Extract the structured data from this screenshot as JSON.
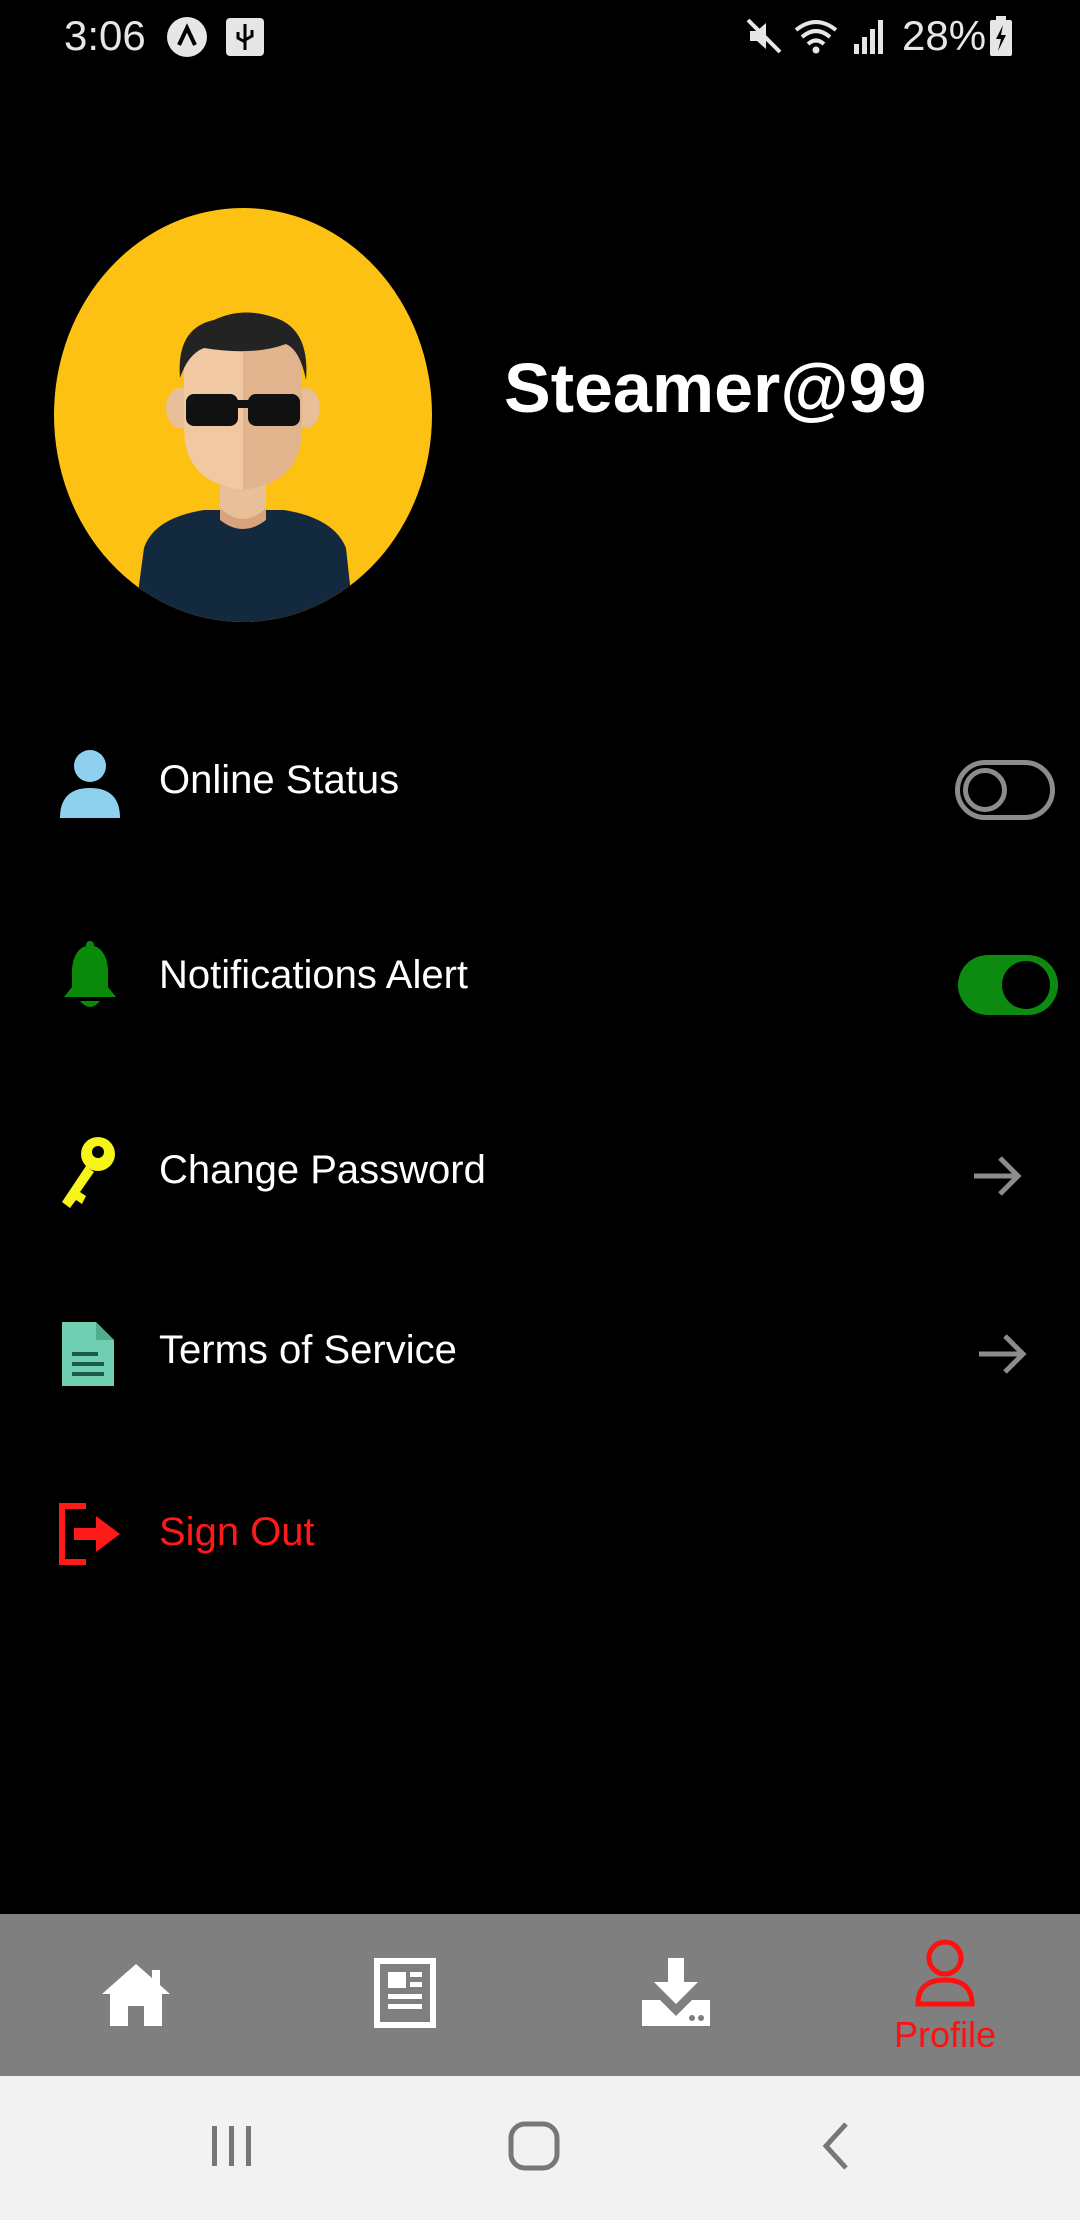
{
  "status_bar": {
    "time": "3:06",
    "battery": "28%",
    "icons": [
      "a-badge-icon",
      "usb-icon",
      "mute-icon",
      "wifi-icon",
      "signal-icon",
      "battery-charging-icon"
    ]
  },
  "profile": {
    "username": "Steamer@99",
    "avatar_bg": "#fdc113"
  },
  "settings": {
    "online_status": {
      "label": "Online Status",
      "icon": "person-icon",
      "enabled": false
    },
    "notifications": {
      "label": "Notifications Alert",
      "icon": "bell-icon",
      "enabled": true
    },
    "change_password": {
      "label": "Change Password",
      "icon": "key-icon"
    },
    "terms": {
      "label": "Terms of Service",
      "icon": "document-icon"
    },
    "sign_out": {
      "label": "Sign Out",
      "icon": "sign-out-icon"
    }
  },
  "tab_bar": {
    "tabs": [
      {
        "name": "home",
        "icon": "home-icon",
        "active": false
      },
      {
        "name": "news",
        "icon": "newspaper-icon",
        "active": false
      },
      {
        "name": "downloads",
        "icon": "download-icon",
        "active": false
      },
      {
        "name": "profile",
        "icon": "person-outline-icon",
        "label": "Profile",
        "active": true
      }
    ]
  },
  "nav_bar": {
    "buttons": [
      "recent-apps-icon",
      "home-circle-icon",
      "back-icon"
    ]
  },
  "colors": {
    "accent": "#ff1010",
    "toggle_on": "#0d8a10",
    "toggle_off": "#8c8c8c",
    "tab_bar_bg": "#7f7f7f"
  }
}
